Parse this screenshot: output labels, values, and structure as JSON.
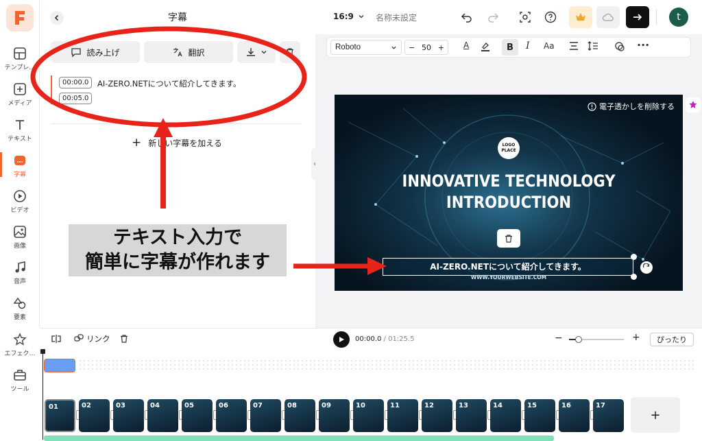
{
  "sidebar": {
    "items": [
      {
        "label": "テンプレ…"
      },
      {
        "label": "メディア"
      },
      {
        "label": "テキスト"
      },
      {
        "label": "字幕"
      },
      {
        "label": "ビデオ"
      },
      {
        "label": "画像"
      },
      {
        "label": "音声"
      },
      {
        "label": "要素"
      },
      {
        "label": "エフェク…"
      },
      {
        "label": "ツール"
      }
    ]
  },
  "panel": {
    "title": "字幕",
    "read_aloud": "読み上げ",
    "translate": "翻訳",
    "subtitle": {
      "start": "00:00.0",
      "end": "00:05.0",
      "text": "AI-ZERO.NETについて紹介してきます。"
    },
    "add_subtitle": "新しい字幕を加える"
  },
  "topbar": {
    "ratio": "16:9",
    "name_placeholder": "名称未設定",
    "avatar": "t"
  },
  "format": {
    "font": "Roboto",
    "size": "50",
    "case": "Aa"
  },
  "canvas": {
    "watermark": "電子透かしを削除する",
    "logo_line1": "LOGO",
    "logo_line2": "PLACE",
    "headline1": "INNOVATIVE TECHNOLOGY",
    "headline2": "INTRODUCTION",
    "subtitle": "AI-ZERO.NETについて紹介してきます。",
    "website": "WWW.YOURWEBSITE.COM"
  },
  "callout": {
    "line1": "テキスト入力で",
    "line2": "簡単に字幕が作れます"
  },
  "timeline": {
    "link": "リンク",
    "time_current": "00:00.0",
    "time_total": " / 01:25.5",
    "fit": "ぴったり",
    "slides": [
      "01",
      "02",
      "03",
      "04",
      "05",
      "06",
      "07",
      "08",
      "09",
      "10",
      "11",
      "12",
      "13",
      "14",
      "15",
      "16",
      "17"
    ]
  },
  "colors": {
    "accent": "#f0642e",
    "annotation": "#e8231a",
    "playhead": "#6a9ef5",
    "audio": "#7fe0b9"
  }
}
